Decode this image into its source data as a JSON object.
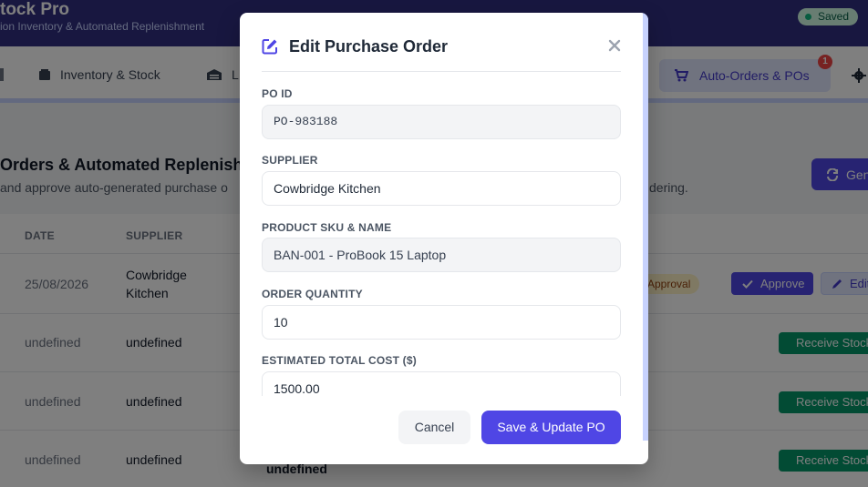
{
  "app": {
    "title": "tock Pro",
    "subtitle": "ion Inventory & Automated Replenishment",
    "saved_label": "Saved"
  },
  "nav": {
    "items": [
      {
        "label": "",
        "icon": "dashboard-icon"
      },
      {
        "label": "Inventory & Stock",
        "icon": "box-icon"
      },
      {
        "label": "L",
        "icon": "warehouse-icon"
      }
    ],
    "active": {
      "label": "Auto-Orders & POs",
      "icon": "cart-icon",
      "badge": "1"
    },
    "settings_icon": "gear-icon"
  },
  "page": {
    "heading": "Orders & Automated Replenish",
    "subheading": "and approve auto-generated purchase o",
    "subheading_end": "dering.",
    "generate_label": "Gen"
  },
  "table": {
    "columns": [
      "DATE",
      "SUPPLIER"
    ],
    "rows": [
      {
        "date": "25/08/2026",
        "supplier": "Cowbridge Kitchen",
        "status": "Approval",
        "approve_label": "Approve",
        "edit_label": "Edit"
      },
      {
        "date": "undefined",
        "supplier": "undefined",
        "receive_label": "Receive Stock"
      },
      {
        "date": "undefined",
        "supplier": "undefined",
        "receive_label": "Receive Stock"
      },
      {
        "date": "undefined",
        "supplier": "undefined",
        "extra": "undefined",
        "receive_label": "Receive Stock"
      }
    ]
  },
  "modal": {
    "title": "Edit Purchase Order",
    "fields": {
      "po_id": {
        "label": "PO ID",
        "value": "PO-983188"
      },
      "supplier": {
        "label": "SUPPLIER",
        "value": "Cowbridge Kitchen"
      },
      "product": {
        "label": "PRODUCT SKU & NAME",
        "value": "BAN-001 - ProBook 15 Laptop"
      },
      "quantity": {
        "label": "ORDER QUANTITY",
        "value": "10"
      },
      "cost": {
        "label": "ESTIMATED TOTAL COST ($)",
        "value": "1500.00"
      }
    },
    "cancel_label": "Cancel",
    "save_label": "Save & Update PO"
  },
  "colors": {
    "brand": "#312e81",
    "accent": "#4f46e5",
    "success": "#059669",
    "warning_bg": "#fef3c7"
  }
}
